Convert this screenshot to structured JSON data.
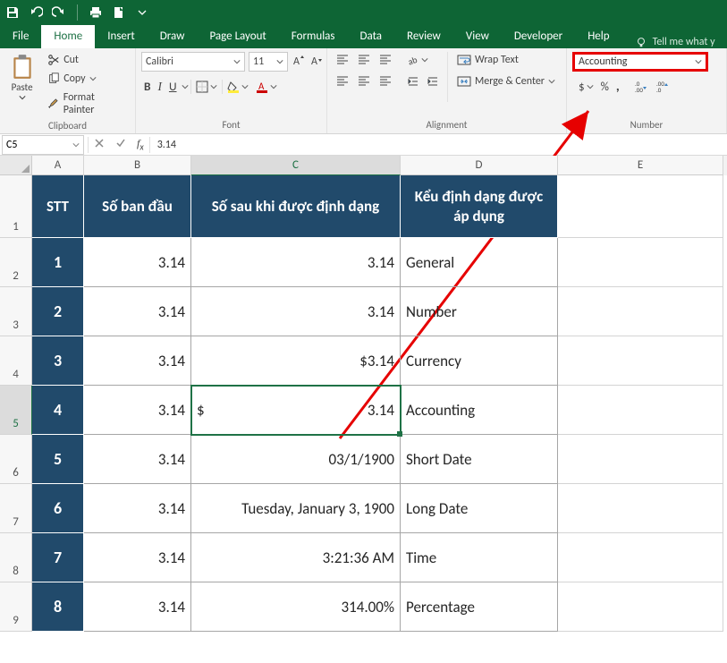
{
  "tabs": {
    "file": "File",
    "home": "Home",
    "insert": "Insert",
    "draw": "Draw",
    "page_layout": "Page Layout",
    "formulas": "Formulas",
    "data": "Data",
    "review": "Review",
    "view": "View",
    "developer": "Developer",
    "help": "Help",
    "tell_me": "Tell me what y"
  },
  "clipboard": {
    "paste": "Paste",
    "cut": "Cut",
    "copy": "Copy",
    "format_painter": "Format Painter",
    "label": "Clipboard"
  },
  "font": {
    "name": "Calibri",
    "size": "11",
    "label": "Font",
    "b": "B",
    "i": "I",
    "u": "U"
  },
  "alignment": {
    "wrap": "Wrap Text",
    "merge": "Merge & Center",
    "label": "Alignment"
  },
  "number": {
    "format": "Accounting",
    "label": "Number",
    "currency": "$",
    "percent": "%",
    "comma": ","
  },
  "namebox": "C5",
  "formula": "3.14",
  "cols": {
    "A": "A",
    "B": "B",
    "C": "C",
    "D": "D",
    "E": "E"
  },
  "rows": {
    "r1": "1",
    "r2": "2",
    "r3": "3",
    "r4": "4",
    "r5": "5",
    "r6": "6",
    "r7": "7",
    "r8": "8",
    "r9": "9"
  },
  "hdr": {
    "stt": "STT",
    "b": "Số ban đầu",
    "c": "Số sau khi được định dạng",
    "d": "Kểu định dạng được áp dụng"
  },
  "stt": {
    "s1": "1",
    "s2": "2",
    "s3": "3",
    "s4": "4",
    "s5": "5",
    "s6": "6",
    "s7": "7",
    "s8": "8"
  },
  "bvals": {
    "v1": "3.14",
    "v2": "3.14",
    "v3": "3.14",
    "v4": "3.14",
    "v5": "3.14",
    "v6": "3.14",
    "v7": "3.14",
    "v8": "3.14"
  },
  "cvals": {
    "v1": "3.14",
    "v2": "3.14",
    "v3": "$3.14",
    "v4_left": "$",
    "v4_right": "3.14",
    "v5": "03/1/1900",
    "v6": "Tuesday, January 3, 1900",
    "v7": "3:21:36 AM",
    "v8": "314.00%"
  },
  "dvals": {
    "v1": "General",
    "v2": "Number",
    "v3": "Currency",
    "v4": "Accounting",
    "v5": "Short Date",
    "v6": "Long Date",
    "v7": "Time",
    "v8": "Percentage"
  }
}
